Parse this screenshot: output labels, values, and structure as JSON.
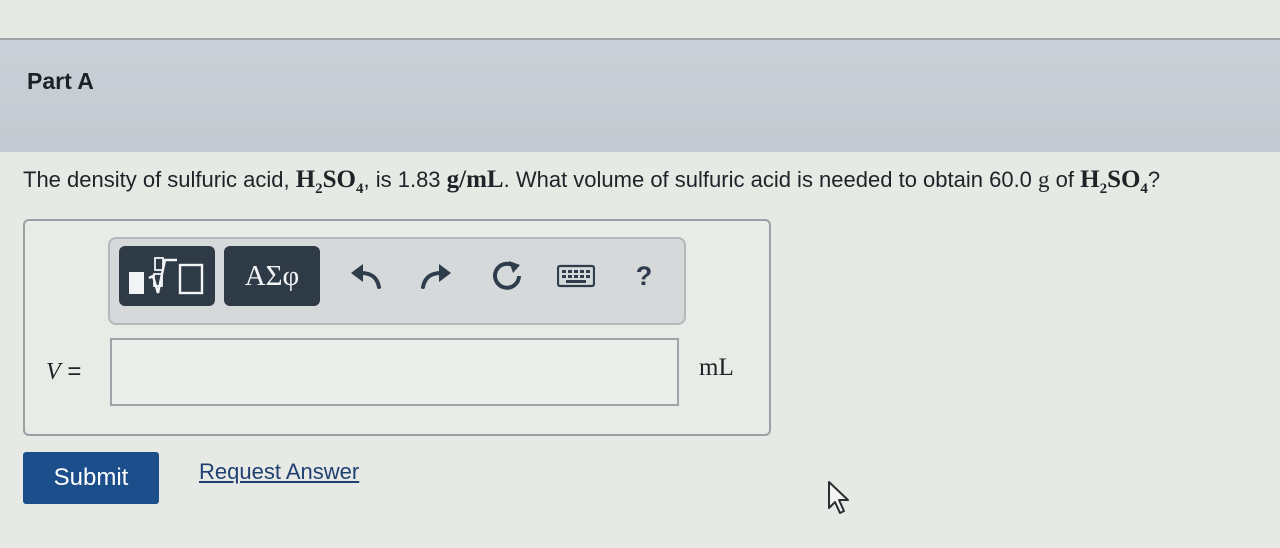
{
  "part": {
    "title": "Part A"
  },
  "question": {
    "text_1": "The density of sulfuric acid, ",
    "formula_1": {
      "h": "H",
      "h_sub": "2",
      "so": "SO",
      "so_sub": "4"
    },
    "text_2": ", is 1.83 ",
    "density_unit": "g/mL",
    "text_3": ". What volume of sulfuric acid is needed to obtain 60.0 ",
    "mass_unit": "g",
    "text_4": " of ",
    "formula_2": {
      "h": "H",
      "h_sub": "2",
      "so": "SO",
      "so_sub": "4"
    },
    "text_5": "?"
  },
  "toolbar": {
    "greek_label": "ΑΣφ",
    "help_label": "?",
    "icons": [
      "templates-icon",
      "undo-icon",
      "redo-icon",
      "reset-icon",
      "keyboard-icon",
      "help-icon"
    ]
  },
  "answer": {
    "variable": "V",
    "equals": " =",
    "value": "",
    "placeholder": "",
    "unit": "mL"
  },
  "actions": {
    "submit_label": "Submit",
    "request_answer_label": "Request Answer"
  },
  "colors": {
    "header_band": "#c6cdd4",
    "toolbar_button": "#2f3a47",
    "submit_button": "#1c4e8c",
    "link": "#1f3f73",
    "icon": "#2e3c4c"
  }
}
